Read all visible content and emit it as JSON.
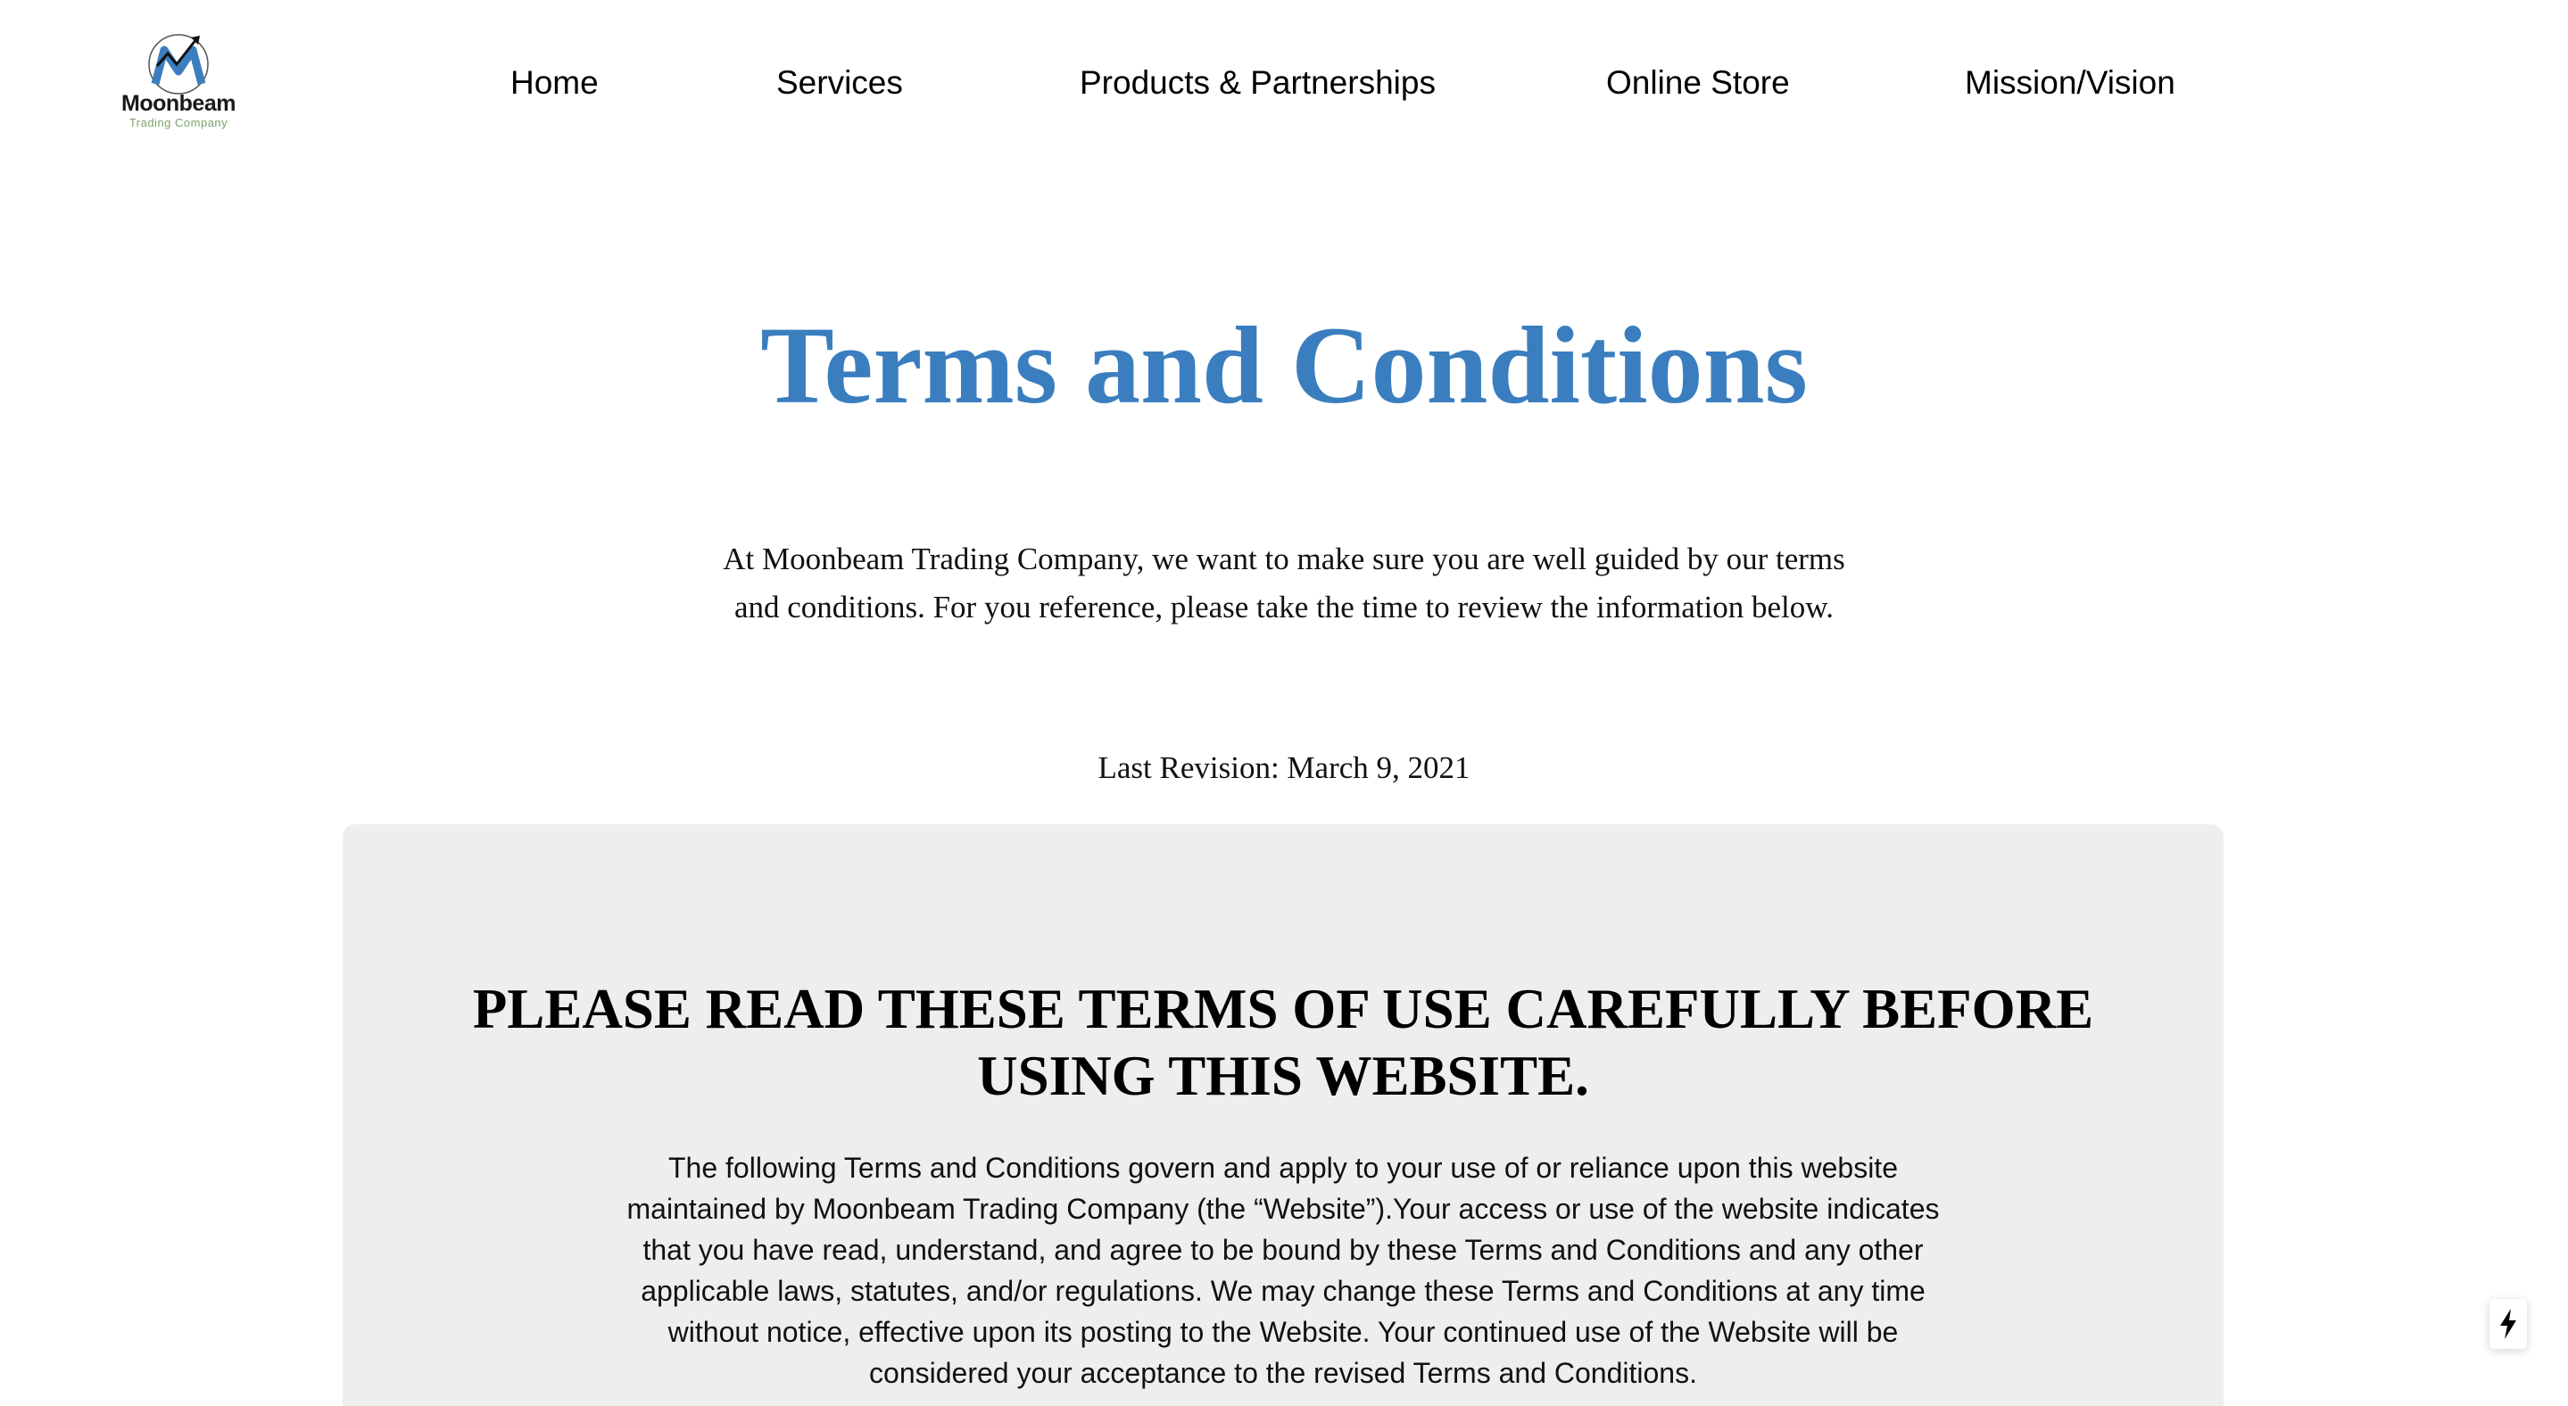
{
  "header": {
    "logo": {
      "name": "Moonbeam",
      "subtitle": "Trading Company",
      "icon": "chart-arrow-m-logo-icon"
    },
    "nav": [
      {
        "label": "Home"
      },
      {
        "label": "Services"
      },
      {
        "label": "Products & Partnerships"
      },
      {
        "label": "Online Store"
      },
      {
        "label": "Mission/Vision"
      }
    ]
  },
  "main": {
    "title": "Terms and Conditions",
    "intro": "At Moonbeam Trading Company, we want to make sure you are well guided by our terms and conditions. For you reference, please take the time to review the information below.",
    "last_revision": "Last Revision: March 9, 2021"
  },
  "terms_panel": {
    "heading": "PLEASE READ THESE TERMS OF USE CAREFULLY BEFORE USING THIS WEBSITE.",
    "body": "The following Terms and Conditions govern and apply to your use of or reliance upon this website maintained by Moonbeam Trading Company (the “Website”).Your access or use of the website indicates that you have read, understand, and agree to be bound by these Terms and Conditions and any other applicable laws, statutes, and/or regulations. We may change these Terms and Conditions at any time without notice, effective upon its posting to the Website. Your continued use of the Website will be considered your acceptance to the revised Terms and Conditions."
  },
  "widget": {
    "icon": "lightning-bolt-icon"
  },
  "colors": {
    "title_blue": "#3a7ebf",
    "panel_bg": "#eeeeee",
    "logo_green": "#7aa36a"
  }
}
